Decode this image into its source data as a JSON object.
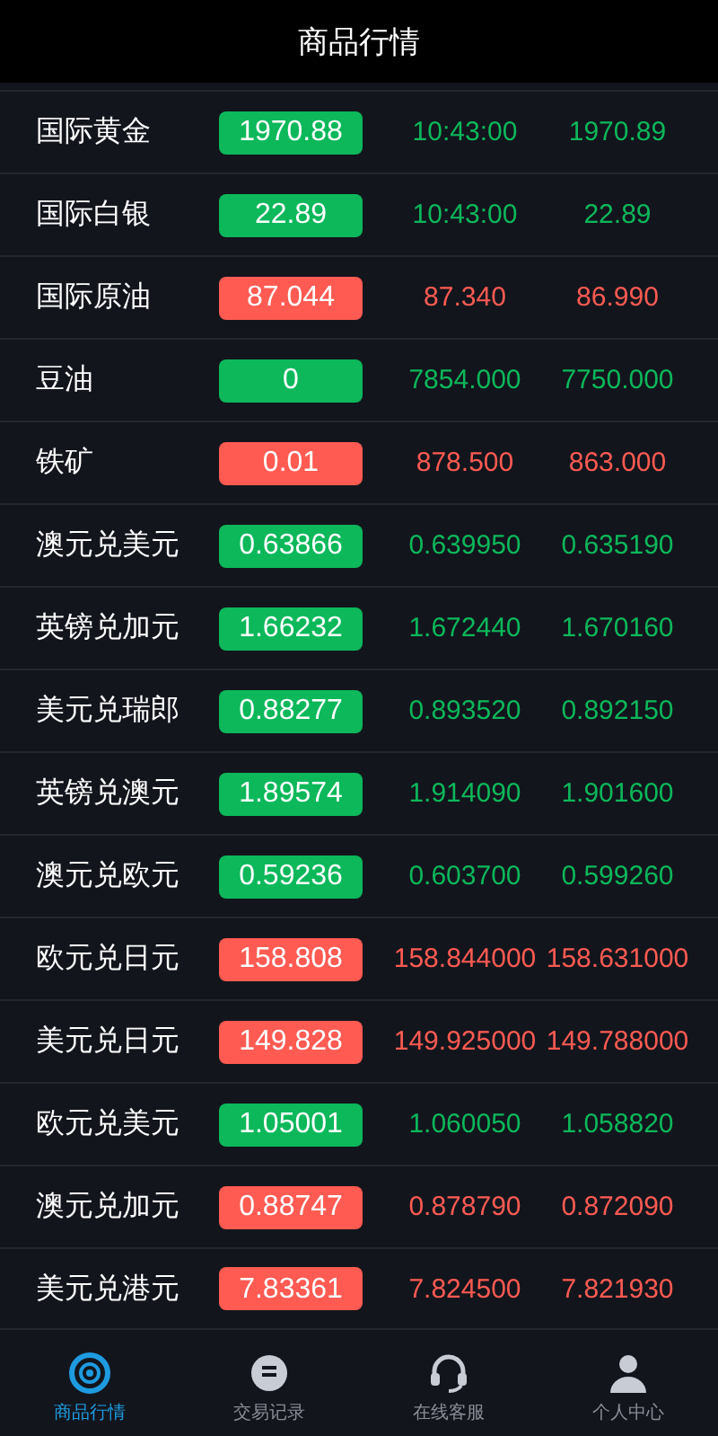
{
  "header": {
    "title": "商品行情"
  },
  "rows": [
    {
      "name": "国际黄金",
      "price": "1970.88",
      "col_3": "10:43:00",
      "col_4": "1970.89",
      "rising": true
    },
    {
      "name": "国际白银",
      "price": "22.89",
      "col_3": "10:43:00",
      "col_4": "22.89",
      "rising": true
    },
    {
      "name": "国际原油",
      "price": "87.044",
      "col_3": "87.340",
      "col_4": "86.990",
      "rising": false
    },
    {
      "name": "豆油",
      "price": "0",
      "col_3": "7854.000",
      "col_4": "7750.000",
      "rising": true
    },
    {
      "name": "铁矿",
      "price": "0.01",
      "col_3": "878.500",
      "col_4": "863.000",
      "rising": false
    },
    {
      "name": "澳元兑美元",
      "price": "0.63866",
      "col_3": "0.639950",
      "col_4": "0.635190",
      "rising": true
    },
    {
      "name": "英镑兑加元",
      "price": "1.66232",
      "col_3": "1.672440",
      "col_4": "1.670160",
      "rising": true
    },
    {
      "name": "美元兑瑞郎",
      "price": "0.88277",
      "col_3": "0.893520",
      "col_4": "0.892150",
      "rising": true
    },
    {
      "name": "英镑兑澳元",
      "price": "1.89574",
      "col_3": "1.914090",
      "col_4": "1.901600",
      "rising": true
    },
    {
      "name": "澳元兑欧元",
      "price": "0.59236",
      "col_3": "0.603700",
      "col_4": "0.599260",
      "rising": true
    },
    {
      "name": "欧元兑日元",
      "price": "158.808",
      "col_3": "158.844000",
      "col_4": "158.631000",
      "rising": false
    },
    {
      "name": "美元兑日元",
      "price": "149.828",
      "col_3": "149.925000",
      "col_4": "149.788000",
      "rising": false
    },
    {
      "name": "欧元兑美元",
      "price": "1.05001",
      "col_3": "1.060050",
      "col_4": "1.058820",
      "rising": true
    },
    {
      "name": "澳元兑加元",
      "price": "0.88747",
      "col_3": "0.878790",
      "col_4": "0.872090",
      "rising": false
    },
    {
      "name": "美元兑港元",
      "price": "7.83361",
      "col_3": "7.824500",
      "col_4": "7.821930",
      "rising": false
    }
  ],
  "nav": [
    {
      "label": "商品行情",
      "kind": "market",
      "selected": true
    },
    {
      "label": "交易记录",
      "kind": "records",
      "selected": false
    },
    {
      "label": "在线客服",
      "kind": "support",
      "selected": false
    },
    {
      "label": "个人中心",
      "kind": "profile",
      "selected": false
    }
  ]
}
